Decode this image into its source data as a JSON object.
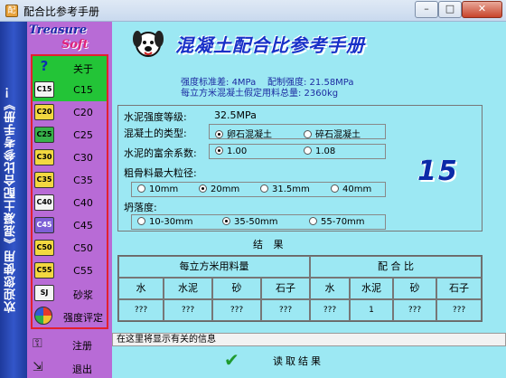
{
  "window": {
    "title": "配合比参考手册",
    "minimize": "–",
    "maximize": "□",
    "close": "✕"
  },
  "banner": {
    "text": "欢迎您使用《混凝土配合比参考手册》！"
  },
  "sidebar": {
    "logo_line1": "Treasure",
    "logo_line2": "Soft",
    "items": [
      {
        "icon": "?",
        "label": "关于"
      },
      {
        "icon": "C15",
        "label": "C15"
      },
      {
        "icon": "C20",
        "label": "C20"
      },
      {
        "icon": "C25",
        "label": "C25"
      },
      {
        "icon": "C30",
        "label": "C30"
      },
      {
        "icon": "C35",
        "label": "C35"
      },
      {
        "icon": "C40",
        "label": "C40"
      },
      {
        "icon": "C45",
        "label": "C45"
      },
      {
        "icon": "C50",
        "label": "C50"
      },
      {
        "icon": "C55",
        "label": "C55"
      },
      {
        "icon": "SJ",
        "label": "砂浆"
      },
      {
        "icon": "",
        "label": "强度评定"
      }
    ],
    "register_label": "注册",
    "exit_label": "退出"
  },
  "header": {
    "title": "混凝土配合比参考手册",
    "std_dev_label": "强度标准差:",
    "std_dev_value": "4MPa",
    "prep_strength_label": "配制强度:",
    "prep_strength_value": "21.58MPa",
    "assumed_mass": "每立方米混凝土假定用料总量: 2360kg"
  },
  "params": {
    "cement_grade_label": "水泥强度等级:",
    "cement_grade_value": "32.5MPa",
    "stone_type_label": "混凝土的类型:",
    "stone_type_options": [
      "卵石混凝土",
      "碎石混凝土"
    ],
    "stone_type_selected": 0,
    "surplus_label": "水泥的富余系数:",
    "surplus_options": [
      "1.00",
      "1.08"
    ],
    "surplus_selected": 0,
    "aggregate_label": "粗骨料最大粒径:",
    "aggregate_options": [
      "10mm",
      "20mm",
      "31.5mm",
      "40mm"
    ],
    "aggregate_selected": 1,
    "slump_label": "坍落度:",
    "slump_options": [
      "10-30mm",
      "35-50mm",
      "55-70mm"
    ],
    "slump_selected": 1
  },
  "grade_display": "15",
  "results": {
    "title": "结 果",
    "usage_header": "每立方米用料量",
    "ratio_header": "配 合 比",
    "columns": [
      "水",
      "水泥",
      "砂",
      "石子",
      "水",
      "水泥",
      "砂",
      "石子"
    ],
    "values": [
      "???",
      "???",
      "???",
      "???",
      "???",
      "1",
      "???",
      "???"
    ]
  },
  "status_text": "在这里将显示有关的信息",
  "read_button_label": "读取结果"
}
